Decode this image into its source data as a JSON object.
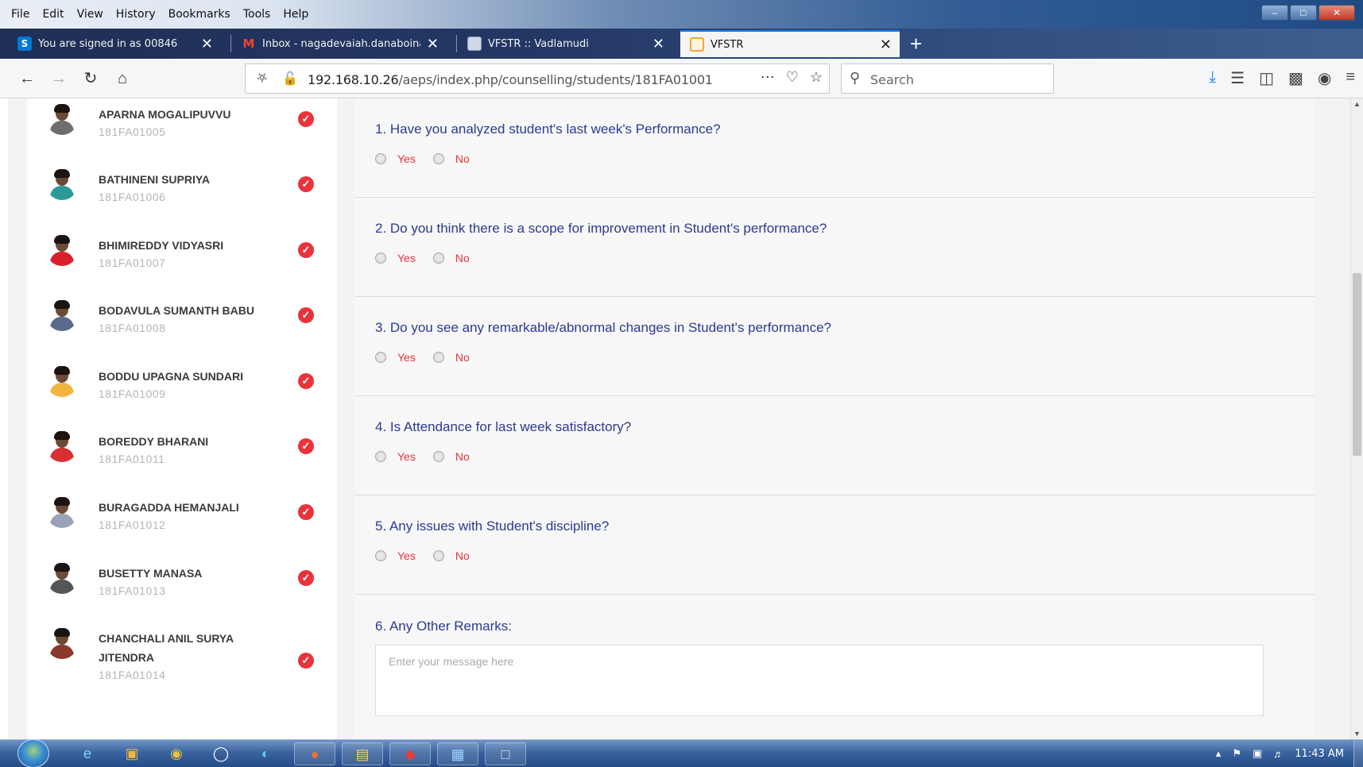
{
  "menubar": {
    "items": [
      "File",
      "Edit",
      "View",
      "History",
      "Bookmarks",
      "Tools",
      "Help"
    ]
  },
  "tabs": [
    {
      "label": "You are signed in as 00846",
      "icon": "skype-icon",
      "color": "#0078d4"
    },
    {
      "label": "Inbox - nagadevaiah.danaboina",
      "icon": "gmail-icon",
      "color": "#ea4335"
    },
    {
      "label": "VFSTR :: Vadlamudi",
      "icon": "page-icon",
      "color": "#cfd8e6"
    },
    {
      "label": "VFSTR",
      "icon": "vfstr-icon",
      "color": "#f2a53a",
      "active": true
    }
  ],
  "navbar": {
    "url_host": "192.168.10.26",
    "url_path": "/aeps/index.php/counselling/students/181FA01001",
    "search_placeholder": "Search"
  },
  "students": [
    {
      "name": "APARNA MOGALIPUVVU",
      "id": "181FA01005",
      "body_color": "#6e6e6e"
    },
    {
      "name": "BATHINENI SUPRIYA",
      "id": "181FA01006",
      "body_color": "#2a9a9a"
    },
    {
      "name": "BHIMIREDDY VIDYASRI",
      "id": "181FA01007",
      "body_color": "#d8202a"
    },
    {
      "name": "BODAVULA SUMANTH BABU",
      "id": "181FA01008",
      "body_color": "#5a6a8a"
    },
    {
      "name": "BODDU UPAGNA SUNDARI",
      "id": "181FA01009",
      "body_color": "#f0b640"
    },
    {
      "name": "BOREDDY BHARANI",
      "id": "181FA01011",
      "body_color": "#d63030"
    },
    {
      "name": "BURAGADDA HEMANJALI",
      "id": "181FA01012",
      "body_color": "#9aa2b8"
    },
    {
      "name": "BUSETTY MANASA",
      "id": "181FA01013",
      "body_color": "#555555"
    },
    {
      "name": "CHANCHALI ANIL SURYA JITENDRA",
      "id": "181FA01014",
      "body_color": "#8a3a2a"
    }
  ],
  "questions": [
    {
      "text": "1. Have you analyzed student's last week's Performance?"
    },
    {
      "text": "2. Do you think there is a scope for improvement in Student's performance?"
    },
    {
      "text": "3. Do you see any remarkable/abnormal changes in Student's performance?"
    },
    {
      "text": "4. Is Attendance for last week satisfactory?"
    },
    {
      "text": "5. Any issues with Student's discipline?"
    }
  ],
  "options": {
    "yes": "Yes",
    "no": "No"
  },
  "remarks": {
    "label": "6. Any Other Remarks:",
    "placeholder": "Enter your message here"
  },
  "taskbar": {
    "clock": "11:43 AM"
  },
  "colors": {
    "question_text": "#2b3a8f",
    "option_text": "#e8333a",
    "check_badge": "#e8333a"
  }
}
